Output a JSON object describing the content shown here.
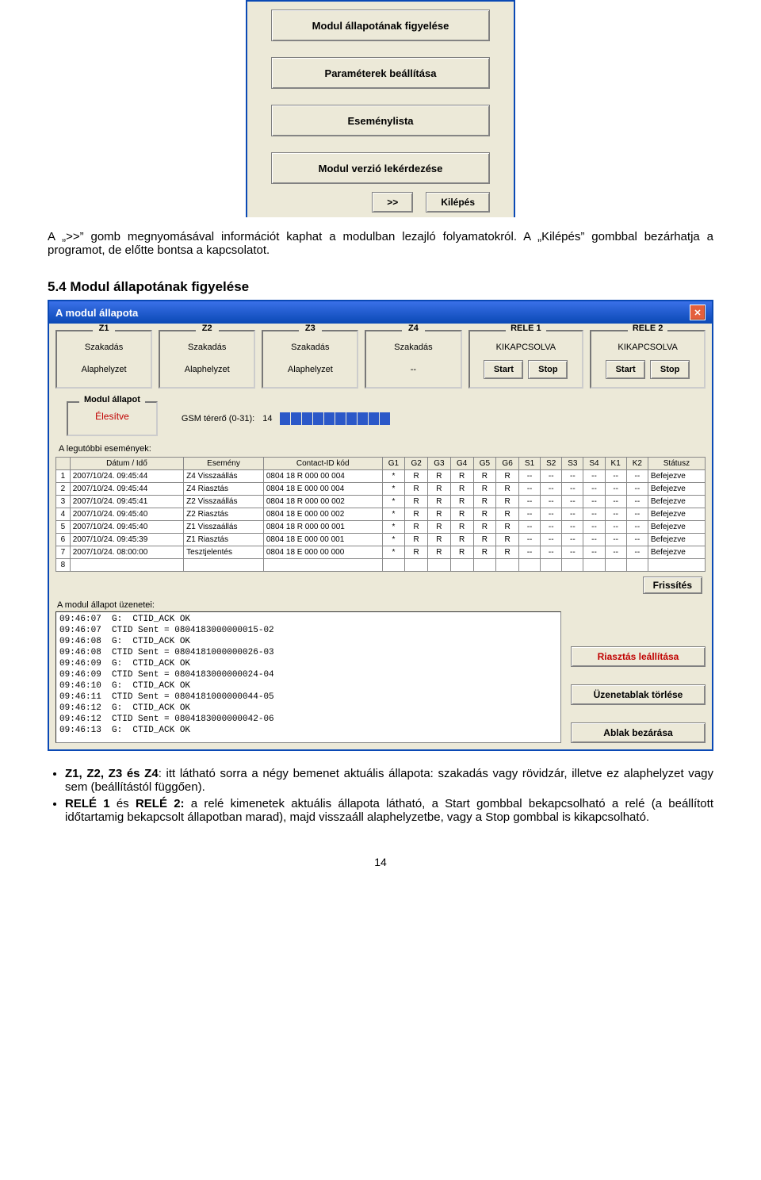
{
  "menu": {
    "btn1": "Modul állapotának figyelése",
    "btn2": "Paraméterek beállítása",
    "btn3": "Eseménylista",
    "btn4": "Modul verzió lekérdezése",
    "next": ">>",
    "exit": "Kilépés"
  },
  "intro": {
    "p1": "A „>>” gomb megnyomásával információt kaphat a modulban lezajló folyamatokról. A „Kilépés” gombbal bezárhatja a programot, de előtte bontsa a kapcsolatot.",
    "h1": "5.4  Modul állapotának figyelése"
  },
  "statwin": {
    "title": "A modul állapota",
    "zones": [
      {
        "hdr": "Z1",
        "l1": "Szakadás",
        "l2": "Alaphelyzet"
      },
      {
        "hdr": "Z2",
        "l1": "Szakadás",
        "l2": "Alaphelyzet"
      },
      {
        "hdr": "Z3",
        "l1": "Szakadás",
        "l2": "Alaphelyzet"
      },
      {
        "hdr": "Z4",
        "l1": "Szakadás",
        "l2": "--"
      }
    ],
    "rele": [
      {
        "hdr": "RELE 1",
        "state": "KIKAPCSOLVA",
        "start": "Start",
        "stop": "Stop"
      },
      {
        "hdr": "RELE 2",
        "state": "KIKAPCSOLVA",
        "start": "Start",
        "stop": "Stop"
      }
    ],
    "modstat_hdr": "Modul állapot",
    "modstat_val": "Élesítve",
    "gsm_label": "GSM térerő (0-31):",
    "gsm_val": "14",
    "legut": "A legutóbbi események:",
    "cols": {
      "idx": "",
      "dt": "Dátum / Idő",
      "ev": "Esemény",
      "cid": "Contact-ID kód",
      "g1": "G1",
      "g2": "G2",
      "g3": "G3",
      "g4": "G4",
      "g5": "G5",
      "g6": "G6",
      "s1": "S1",
      "s2": "S2",
      "s3": "S3",
      "s4": "S4",
      "k1": "K1",
      "k2": "K2",
      "stat": "Státusz"
    },
    "rows": [
      {
        "i": "1",
        "dt": "2007/10/24. 09:45:44",
        "ev": "Z4 Visszaállás",
        "cid": "0804 18 R 000 00 004",
        "g1": "*",
        "g2": "R",
        "g3": "R",
        "g4": "R",
        "g5": "R",
        "g6": "R",
        "s1": "--",
        "s2": "--",
        "s3": "--",
        "s4": "--",
        "k1": "--",
        "k2": "--",
        "st": "Befejezve"
      },
      {
        "i": "2",
        "dt": "2007/10/24. 09:45:44",
        "ev": "Z4 Riasztás",
        "cid": "0804 18 E 000 00 004",
        "g1": "*",
        "g2": "R",
        "g3": "R",
        "g4": "R",
        "g5": "R",
        "g6": "R",
        "s1": "--",
        "s2": "--",
        "s3": "--",
        "s4": "--",
        "k1": "--",
        "k2": "--",
        "st": "Befejezve"
      },
      {
        "i": "3",
        "dt": "2007/10/24. 09:45:41",
        "ev": "Z2 Visszaállás",
        "cid": "0804 18 R 000 00 002",
        "g1": "*",
        "g2": "R",
        "g3": "R",
        "g4": "R",
        "g5": "R",
        "g6": "R",
        "s1": "--",
        "s2": "--",
        "s3": "--",
        "s4": "--",
        "k1": "--",
        "k2": "--",
        "st": "Befejezve"
      },
      {
        "i": "4",
        "dt": "2007/10/24. 09:45:40",
        "ev": "Z2 Riasztás",
        "cid": "0804 18 E 000 00 002",
        "g1": "*",
        "g2": "R",
        "g3": "R",
        "g4": "R",
        "g5": "R",
        "g6": "R",
        "s1": "--",
        "s2": "--",
        "s3": "--",
        "s4": "--",
        "k1": "--",
        "k2": "--",
        "st": "Befejezve"
      },
      {
        "i": "5",
        "dt": "2007/10/24. 09:45:40",
        "ev": "Z1 Visszaállás",
        "cid": "0804 18 R 000 00 001",
        "g1": "*",
        "g2": "R",
        "g3": "R",
        "g4": "R",
        "g5": "R",
        "g6": "R",
        "s1": "--",
        "s2": "--",
        "s3": "--",
        "s4": "--",
        "k1": "--",
        "k2": "--",
        "st": "Befejezve"
      },
      {
        "i": "6",
        "dt": "2007/10/24. 09:45:39",
        "ev": "Z1 Riasztás",
        "cid": "0804 18 E 000 00 001",
        "g1": "*",
        "g2": "R",
        "g3": "R",
        "g4": "R",
        "g5": "R",
        "g6": "R",
        "s1": "--",
        "s2": "--",
        "s3": "--",
        "s4": "--",
        "k1": "--",
        "k2": "--",
        "st": "Befejezve"
      },
      {
        "i": "7",
        "dt": "2007/10/24. 08:00:00",
        "ev": "Tesztjelentés",
        "cid": "0804 18 E 000 00 000",
        "g1": "*",
        "g2": "R",
        "g3": "R",
        "g4": "R",
        "g5": "R",
        "g6": "R",
        "s1": "--",
        "s2": "--",
        "s3": "--",
        "s4": "--",
        "k1": "--",
        "k2": "--",
        "st": "Befejezve"
      },
      {
        "i": "8",
        "dt": "",
        "ev": "",
        "cid": "",
        "g1": "",
        "g2": "",
        "g3": "",
        "g4": "",
        "g5": "",
        "g6": "",
        "s1": "",
        "s2": "",
        "s3": "",
        "s4": "",
        "k1": "",
        "k2": "",
        "st": ""
      }
    ],
    "refresh": "Frissítés",
    "msgs_title": "A modul állapot üzenetei:",
    "msgs": "09:46:07  G:  CTID_ACK OK\n09:46:07  CTID Sent = 0804183000000015-02\n09:46:08  G:  CTID_ACK OK\n09:46:08  CTID Sent = 0804181000000026-03\n09:46:09  G:  CTID_ACK OK\n09:46:09  CTID Sent = 0804183000000024-04\n09:46:10  G:  CTID_ACK OK\n09:46:11  CTID Sent = 0804181000000044-05\n09:46:12  G:  CTID_ACK OK\n09:46:12  CTID Sent = 0804183000000042-06\n09:46:13  G:  CTID_ACK OK",
    "btn_stopalarm": "Riasztás leállítása",
    "btn_clearmsgs": "Üzenetablak törlése",
    "btn_closewin": "Ablak bezárása"
  },
  "bullets": {
    "b1_lead": "Z1, Z2, Z3 és Z4",
    "b1_rest": ": itt látható sorra a négy bemenet aktuális állapota: szakadás vagy rövidzár, illetve ez alaphelyzet vagy sem (beállítástól függően).",
    "b2_lead1": "RELÉ 1",
    "b2_mid": " és ",
    "b2_lead2": "RELÉ 2:",
    "b2_rest": " a relé kimenetek aktuális állapota látható, a Start gombbal bekapcsolható a relé (a beállított időtartamig bekapcsolt állapotban marad), majd visszaáll alaphelyzetbe, vagy a Stop gombbal is kikapcsolható."
  },
  "page_number": "14"
}
